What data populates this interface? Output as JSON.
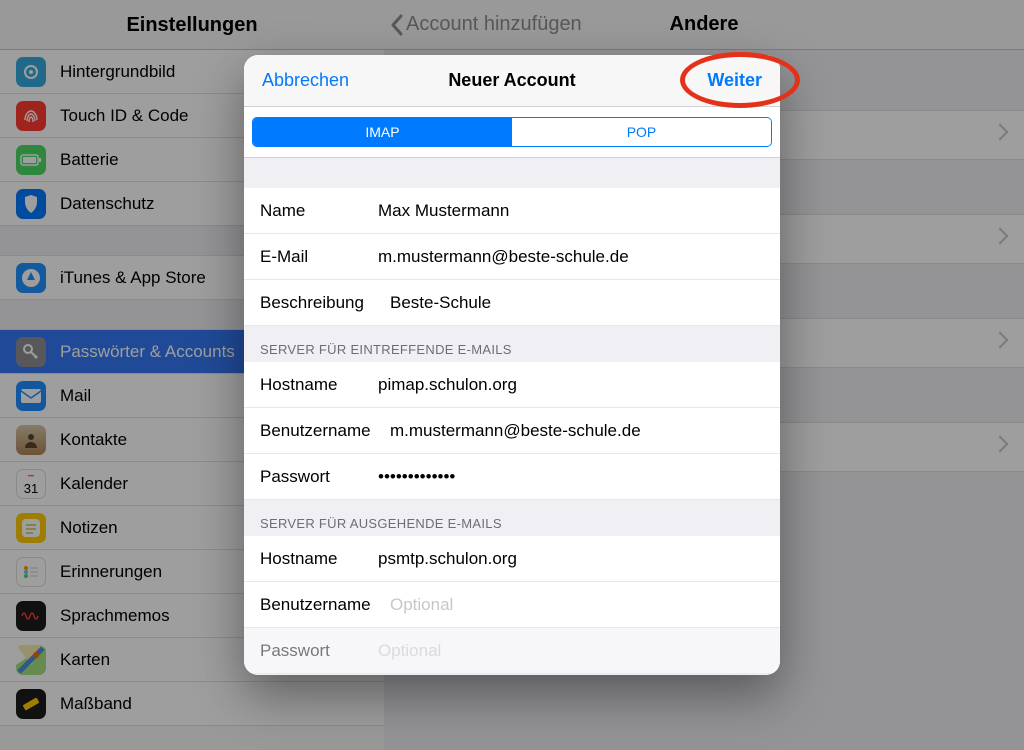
{
  "sidebar": {
    "title": "Einstellungen",
    "groups": [
      [
        {
          "icon": "wallpaper",
          "color": "#34aadc",
          "label": "Hintergrundbild"
        },
        {
          "icon": "touchid",
          "color": "#ff3b30",
          "label": "Touch ID & Code"
        },
        {
          "icon": "battery",
          "color": "#4cd964",
          "label": "Batterie"
        },
        {
          "icon": "privacy",
          "color": "#007aff",
          "label": "Datenschutz"
        }
      ],
      [
        {
          "icon": "appstore",
          "color": "#1e90ff",
          "label": "iTunes & App Store"
        }
      ],
      [
        {
          "icon": "key",
          "color": "#8e8e93",
          "label": "Passwörter & Accounts",
          "selected": true
        },
        {
          "icon": "mail",
          "color": "#1f8fff",
          "label": "Mail"
        },
        {
          "icon": "contacts",
          "color": "#b08457",
          "label": "Kontakte"
        },
        {
          "icon": "calendar",
          "color": "#ffffff",
          "label": "Kalender"
        },
        {
          "icon": "notes",
          "color": "#ffcc00",
          "label": "Notizen"
        },
        {
          "icon": "reminders",
          "color": "#ffffff",
          "label": "Erinnerungen"
        },
        {
          "icon": "voicememos",
          "color": "#1c1c1e",
          "label": "Sprachmemos"
        },
        {
          "icon": "maps",
          "color": "#ffffff",
          "label": "Karten"
        },
        {
          "icon": "measure",
          "color": "#1c1c1e",
          "label": "Maßband"
        }
      ]
    ]
  },
  "detail": {
    "back": "Account hinzufügen",
    "title": "Andere"
  },
  "modal": {
    "cancel": "Abbrechen",
    "title": "Neuer Account",
    "next": "Weiter",
    "segments": {
      "imap": "IMAP",
      "pop": "POP",
      "active": "imap"
    },
    "account": {
      "name_label": "Name",
      "name_value": "Max Mustermann",
      "email_label": "E-Mail",
      "email_value": "m.mustermann@beste-schule.de",
      "desc_label": "Beschreibung",
      "desc_value": "Beste-Schule"
    },
    "incoming": {
      "header": "Server für eintreffende E-Mails",
      "host_label": "Hostname",
      "host_value": "pimap.schulon.org",
      "user_label": "Benutzername",
      "user_value": "m.mustermann@beste-schule.de",
      "pass_label": "Passwort",
      "pass_value": "•••••••••••••"
    },
    "outgoing": {
      "header": "Server für ausgehende E-Mails",
      "host_label": "Hostname",
      "host_value": "psmtp.schulon.org",
      "user_label": "Benutzername",
      "user_placeholder": "Optional",
      "pass_label": "Passwort",
      "pass_placeholder": "Optional"
    }
  }
}
